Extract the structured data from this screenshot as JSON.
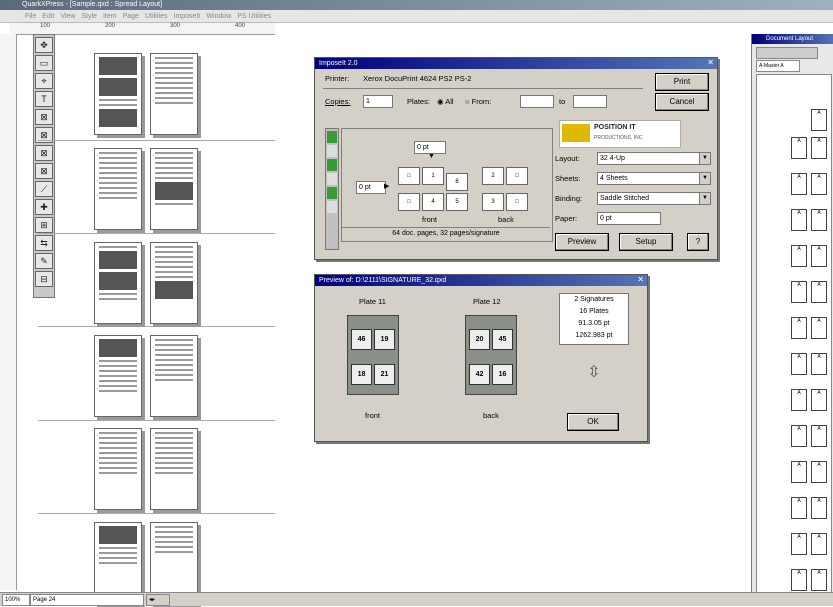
{
  "window": {
    "title": "QuarkXPress - [Sample.qxd : Spread Layout]"
  },
  "menu": {
    "items": [
      "File",
      "Edit",
      "View",
      "Style",
      "Item",
      "Page",
      "Utilities",
      "ImposeIt",
      "Window",
      "PS Utilities"
    ]
  },
  "ruler": {
    "labels": [
      "100",
      "200",
      "300",
      "400"
    ]
  },
  "tools": {
    "items": [
      "✥",
      "▭",
      "⌖",
      "T",
      "⊠",
      "⊠",
      "⊠",
      "⊠",
      "⟋",
      "✚",
      "⊞",
      "⇆",
      "✎",
      "⊟"
    ]
  },
  "print_dialog": {
    "title": "ImposeIt 2.0",
    "printer_label": "Printer:",
    "printer_value": "Xerox DocuPrint 4624 PS2 PS-2",
    "copies_label": "Copies:",
    "copies_value": "1",
    "plates_label": "Plates:",
    "plates_all": "All",
    "plates_from": "From:",
    "to_label": "to",
    "print_button": "Print",
    "cancel_button": "Cancel",
    "gutter_top": "0 pt",
    "gutter_left": "0 pt",
    "front_label": "front",
    "back_label": "back",
    "status_text": "64 doc. pages, 32 pages/signature",
    "layout_label": "Layout:",
    "layout_value": "32 4-Up",
    "sheets_label": "Sheets:",
    "sheets_value": "4 Sheets",
    "binding_label": "Binding:",
    "binding_value": "Saddle Stitched",
    "paper_label": "Paper:",
    "paper_value": "0 pt",
    "preview_button": "Preview",
    "setup_button": "Setup",
    "help_button": "?",
    "logo_text": "POSITION IT",
    "logo_sub": "PRODUCTIONS, INC"
  },
  "preview_dialog": {
    "title": "Preview of: D:\\2111\\SIGNATURE_32.qxd",
    "plate1_label": "Plate 11",
    "plate2_label": "Plate 12",
    "front_label": "front",
    "back_label": "back",
    "info": [
      "2 Signatures",
      "16 Plates",
      "91.3.05 pt",
      "1262.983 pt"
    ],
    "ok_button": "OK",
    "plate1_cells": [
      "46",
      "19",
      "18",
      "21"
    ],
    "plate2_cells": [
      "20",
      "45",
      "42",
      "16"
    ]
  },
  "right_panel": {
    "title": "Document Layout",
    "master": "A-Master A"
  },
  "status": {
    "zoom": "100%",
    "page": "Page 24"
  }
}
